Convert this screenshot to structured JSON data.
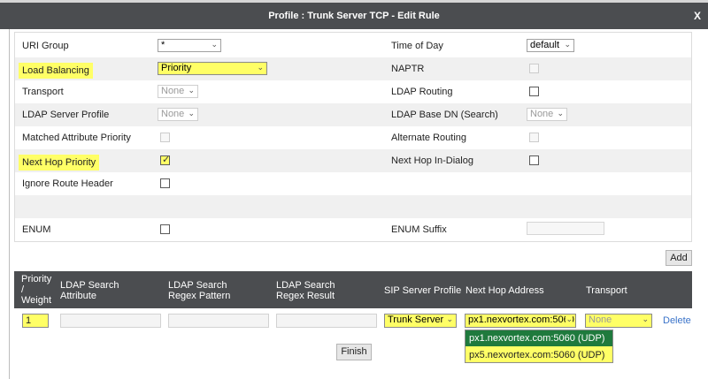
{
  "dialog": {
    "title": "Profile : Trunk Server TCP - Edit Rule",
    "close": "X"
  },
  "form": {
    "uri_group": {
      "label": "URI Group",
      "value": "*"
    },
    "load_balancing": {
      "label": "Load Balancing",
      "value": "Priority"
    },
    "transport": {
      "label": "Transport",
      "value": "None"
    },
    "ldap_server_profile": {
      "label": "LDAP Server Profile",
      "value": "None"
    },
    "matched_attribute_priority": {
      "label": "Matched Attribute Priority",
      "checked": false
    },
    "next_hop_priority": {
      "label": "Next Hop Priority",
      "checked": true
    },
    "ignore_route_header": {
      "label": "Ignore Route Header",
      "checked": false
    },
    "enum": {
      "label": "ENUM",
      "checked": false
    },
    "time_of_day": {
      "label": "Time of Day",
      "value": "default"
    },
    "naptr": {
      "label": "NAPTR",
      "checked": false
    },
    "ldap_routing": {
      "label": "LDAP Routing",
      "checked": false
    },
    "ldap_base_dn": {
      "label": "LDAP Base DN (Search)",
      "value": "None"
    },
    "alternate_routing": {
      "label": "Alternate Routing",
      "checked": false
    },
    "next_hop_in_dialog": {
      "label": "Next Hop In-Dialog",
      "checked": false
    },
    "enum_suffix": {
      "label": "ENUM Suffix",
      "value": ""
    }
  },
  "add_label": "Add",
  "grid": {
    "headers": {
      "priority": [
        "Priority",
        "/",
        "Weight"
      ],
      "ldap_attr": [
        "LDAP Search",
        "Attribute"
      ],
      "ldap_regex": [
        "LDAP Search",
        "Regex Pattern"
      ],
      "ldap_result": [
        "LDAP Search",
        "Regex Result"
      ],
      "sip_server_profile": "SIP Server Profile",
      "next_hop_address": "Next Hop Address",
      "transport": "Transport"
    },
    "row": {
      "priority": "1",
      "sip_server_profile": "Trunk Server",
      "next_hop_address": "px1.nexvortex.com:5060",
      "transport": "None",
      "delete_label": "Delete"
    },
    "next_hop_options": [
      {
        "label": "px1.nexvortex.com:5060 (UDP)",
        "selected": true
      },
      {
        "label": "px5.nexvortex.com:5060 (UDP)",
        "selected": false
      }
    ]
  },
  "finish_label": "Finish",
  "colors": {
    "titlebar": "#4b4d50",
    "highlight": "#ffff66",
    "selected_option": "#1f7a3d",
    "link": "#3a73c9"
  }
}
